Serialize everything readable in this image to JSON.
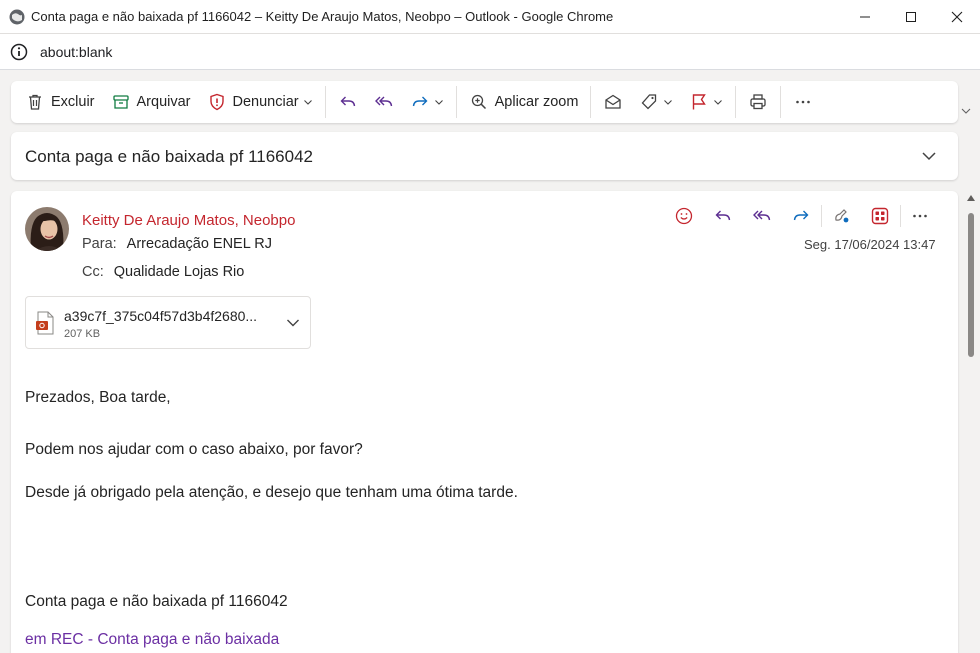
{
  "window": {
    "title": "Conta paga e não baixada pf 1166042 – Keitty De Araujo Matos, Neobpo – Outlook - Google Chrome",
    "controls": [
      "minimize-icon",
      "maximize-icon",
      "close-icon"
    ]
  },
  "address_bar": {
    "url": "about:blank"
  },
  "toolbar": {
    "delete_label": "Excluir",
    "archive_label": "Arquivar",
    "report_label": "Denunciar",
    "zoom_label": "Aplicar zoom",
    "icons": [
      "delete-icon",
      "archive-icon",
      "report-shield-icon",
      "reply-icon",
      "reply-all-icon",
      "forward-icon",
      "zoom-icon",
      "mark-read-icon",
      "tag-icon",
      "flag-icon",
      "print-icon",
      "more-icon"
    ],
    "colors": {
      "reply": "#5c2e91",
      "forward": "#0f6cbd",
      "report": "#c4262e",
      "archive": "#107c41",
      "flag": "#c4262e"
    }
  },
  "subject": "Conta paga e não baixada pf 1166042",
  "message": {
    "sender": "Keitty De Araujo Matos, Neobpo",
    "sender_color": "#c4262e",
    "to_key": "Para:",
    "to_value": "Arrecadação ENEL RJ",
    "cc_key": "Cc:",
    "cc_value": "Qualidade Lojas Rio",
    "date": "Seg. 17/06/2024 13:47",
    "action_icons": [
      "emoji-icon",
      "reply-icon",
      "reply-all-icon",
      "forward-icon",
      "viva-insights-icon",
      "apps-icon",
      "more-icon"
    ],
    "attachment": {
      "name": "a39c7f_375c04f57d3b4f2680...",
      "size": "207 KB",
      "icon": "pdf-file-icon"
    },
    "body": [
      "Prezados, Boa tarde,",
      "Podem  nos ajudar com o caso abaixo, por favor?",
      "Desde já obrigado pela atenção, e desejo que tenham uma ótima tarde.",
      "Conta paga e não baixada pf 1166042"
    ],
    "link_text": "em REC - Conta paga e não baixada",
    "link_color": "#6b2fa3"
  }
}
